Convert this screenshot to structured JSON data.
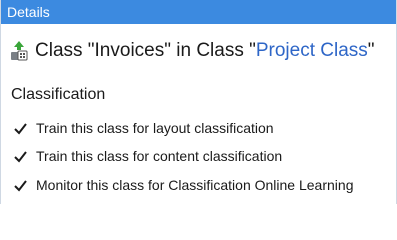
{
  "header": {
    "title": "Details"
  },
  "title_row": {
    "icon": "class-icon",
    "prefix": "Class \"Invoices\" in Class \"",
    "parent_link": "Project Class",
    "suffix": "\""
  },
  "classification": {
    "section_label": "Classification",
    "options": [
      {
        "label": "Train this class for layout classification",
        "checked": true
      },
      {
        "label": "Train this class for content classification",
        "checked": true
      },
      {
        "label": "Monitor this class for Classification Online Learning",
        "checked": true
      }
    ]
  },
  "colors": {
    "header_bg": "#3c8ae0",
    "link": "#2e66c7"
  }
}
